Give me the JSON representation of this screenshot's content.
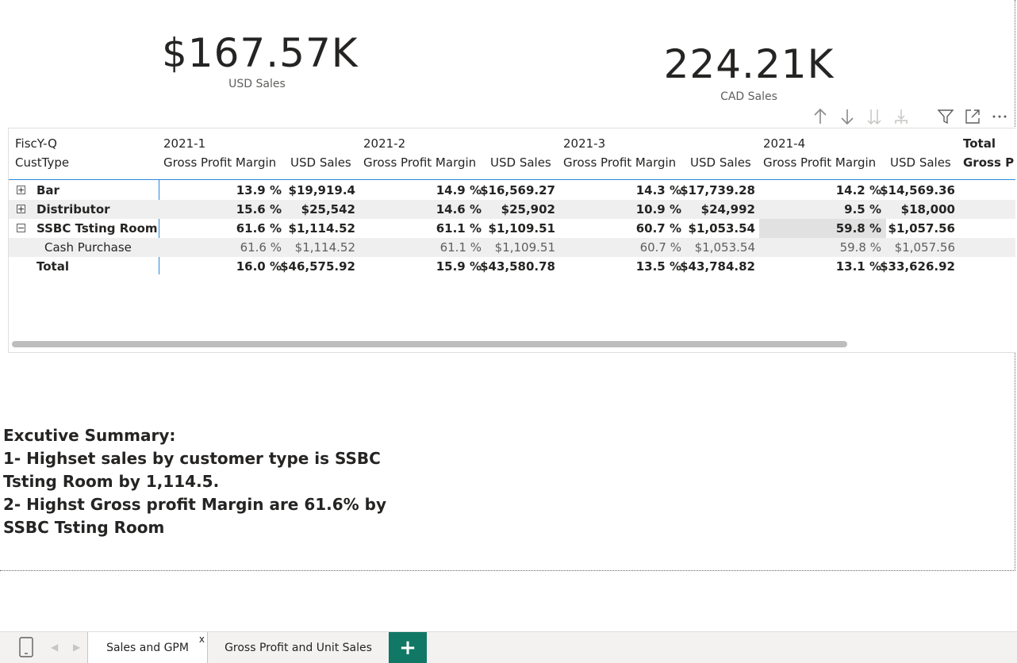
{
  "kpis": {
    "usd": {
      "value": "$167.57K",
      "label": "USD Sales"
    },
    "cad": {
      "value": "224.21K",
      "label": "CAD Sales"
    }
  },
  "toolbar": {
    "icons": [
      "arrow-up-icon",
      "arrow-down-icon",
      "double-arrow-down-icon",
      "expand-hierarchy-icon",
      "filter-icon",
      "focus-mode-icon",
      "more-options-icon"
    ]
  },
  "matrix": {
    "row_header_top": "FiscY-Q",
    "row_header_bottom": "CustType",
    "periods": [
      "2021-1",
      "2021-2",
      "2021-3",
      "2021-4"
    ],
    "measure_gpm": "Gross Profit Margin",
    "measure_usd": "USD Sales",
    "total_label": "Total",
    "total_measure": "Gross P",
    "rows": [
      {
        "expander": "+",
        "name": "Bar",
        "values": [
          "13.9 %",
          "$19,919.4",
          "14.9 %",
          "$16,569.27",
          "14.3 %",
          "$17,739.28",
          "14.2 %",
          "$14,569.36"
        ]
      },
      {
        "expander": "+",
        "name": "Distributor",
        "values": [
          "15.6 %",
          "$25,542",
          "14.6 %",
          "$25,902",
          "10.9 %",
          "$24,992",
          "9.5 %",
          "$18,000"
        ]
      },
      {
        "expander": "−",
        "name": "SSBC Tsting Room",
        "values": [
          "61.6 %",
          "$1,114.52",
          "61.1 %",
          "$1,109.51",
          "60.7 %",
          "$1,053.54",
          "59.8 %",
          "$1,057.56"
        ]
      },
      {
        "expander": "",
        "name": "Cash Purchase",
        "values": [
          "61.6 %",
          "$1,114.52",
          "61.1 %",
          "$1,109.51",
          "60.7 %",
          "$1,053.54",
          "59.8 %",
          "$1,057.56"
        ]
      },
      {
        "expander": "",
        "name": "Total",
        "values": [
          "16.0 %",
          "$46,575.92",
          "15.9 %",
          "$43,580.78",
          "13.5 %",
          "$43,784.82",
          "13.1 %",
          "$33,626.92"
        ]
      }
    ]
  },
  "summary": {
    "line1": "Excutive Summary:",
    "line2": "1- Highset sales by customer type is SSBC Tsting Room by 1,114.5.",
    "line3": "2- Highst Gross profit Margin are 61.6%  by SSBC Tsting Room"
  },
  "tabs": {
    "active": "Sales and GPM",
    "close": "x",
    "other": "Gross Profit and Unit Sales",
    "add": "+"
  },
  "colors": {
    "accent": "#2b88d8",
    "add_button": "#117865"
  }
}
